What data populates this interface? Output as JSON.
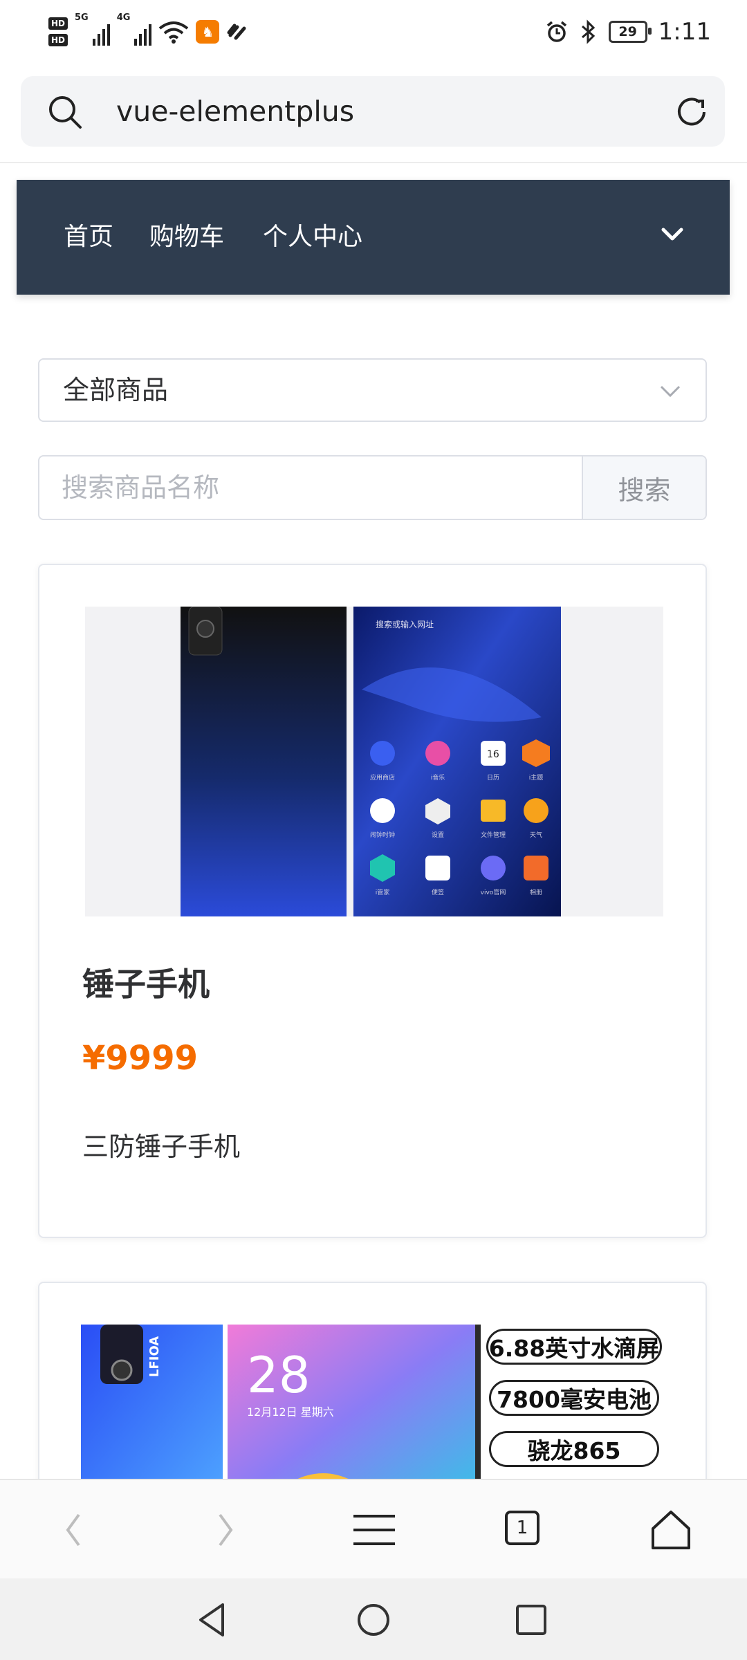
{
  "status_bar": {
    "hd1": "HD",
    "hd2": "HD",
    "net1": "5G",
    "net2": "4G",
    "battery": "29",
    "time": "1:11"
  },
  "browser": {
    "url": "vue-elementplus",
    "tab_count": "1"
  },
  "nav": {
    "items": [
      {
        "label": "首页"
      },
      {
        "label": "购物车"
      },
      {
        "label": "个人中心"
      }
    ]
  },
  "filter": {
    "category_selected": "全部商品",
    "search_placeholder": "搜索商品名称",
    "search_button": "搜索"
  },
  "products": [
    {
      "title": "锤子手机",
      "price": "¥9999",
      "description": "三防锤子手机",
      "image_text": [
        "搜索或输入网址",
        "16"
      ],
      "image_apps": [
        "应用商店",
        "i音乐",
        "日历",
        "i主题",
        "闹钟时钟",
        "设置",
        "文件管理",
        "天气",
        "i管家",
        "便签",
        "vivo官网",
        "相册"
      ]
    },
    {
      "image_text": {
        "date_day": "28",
        "date_line": "12月12日 星期六",
        "brand": "LFIOA",
        "specs": [
          "6.88英寸水滴屏",
          "7800毫安电池",
          "骁龙865"
        ]
      }
    }
  ],
  "colors": {
    "navbar_bg": "#2f3d4f",
    "price": "#f56c00",
    "border": "#dcdfe6"
  }
}
